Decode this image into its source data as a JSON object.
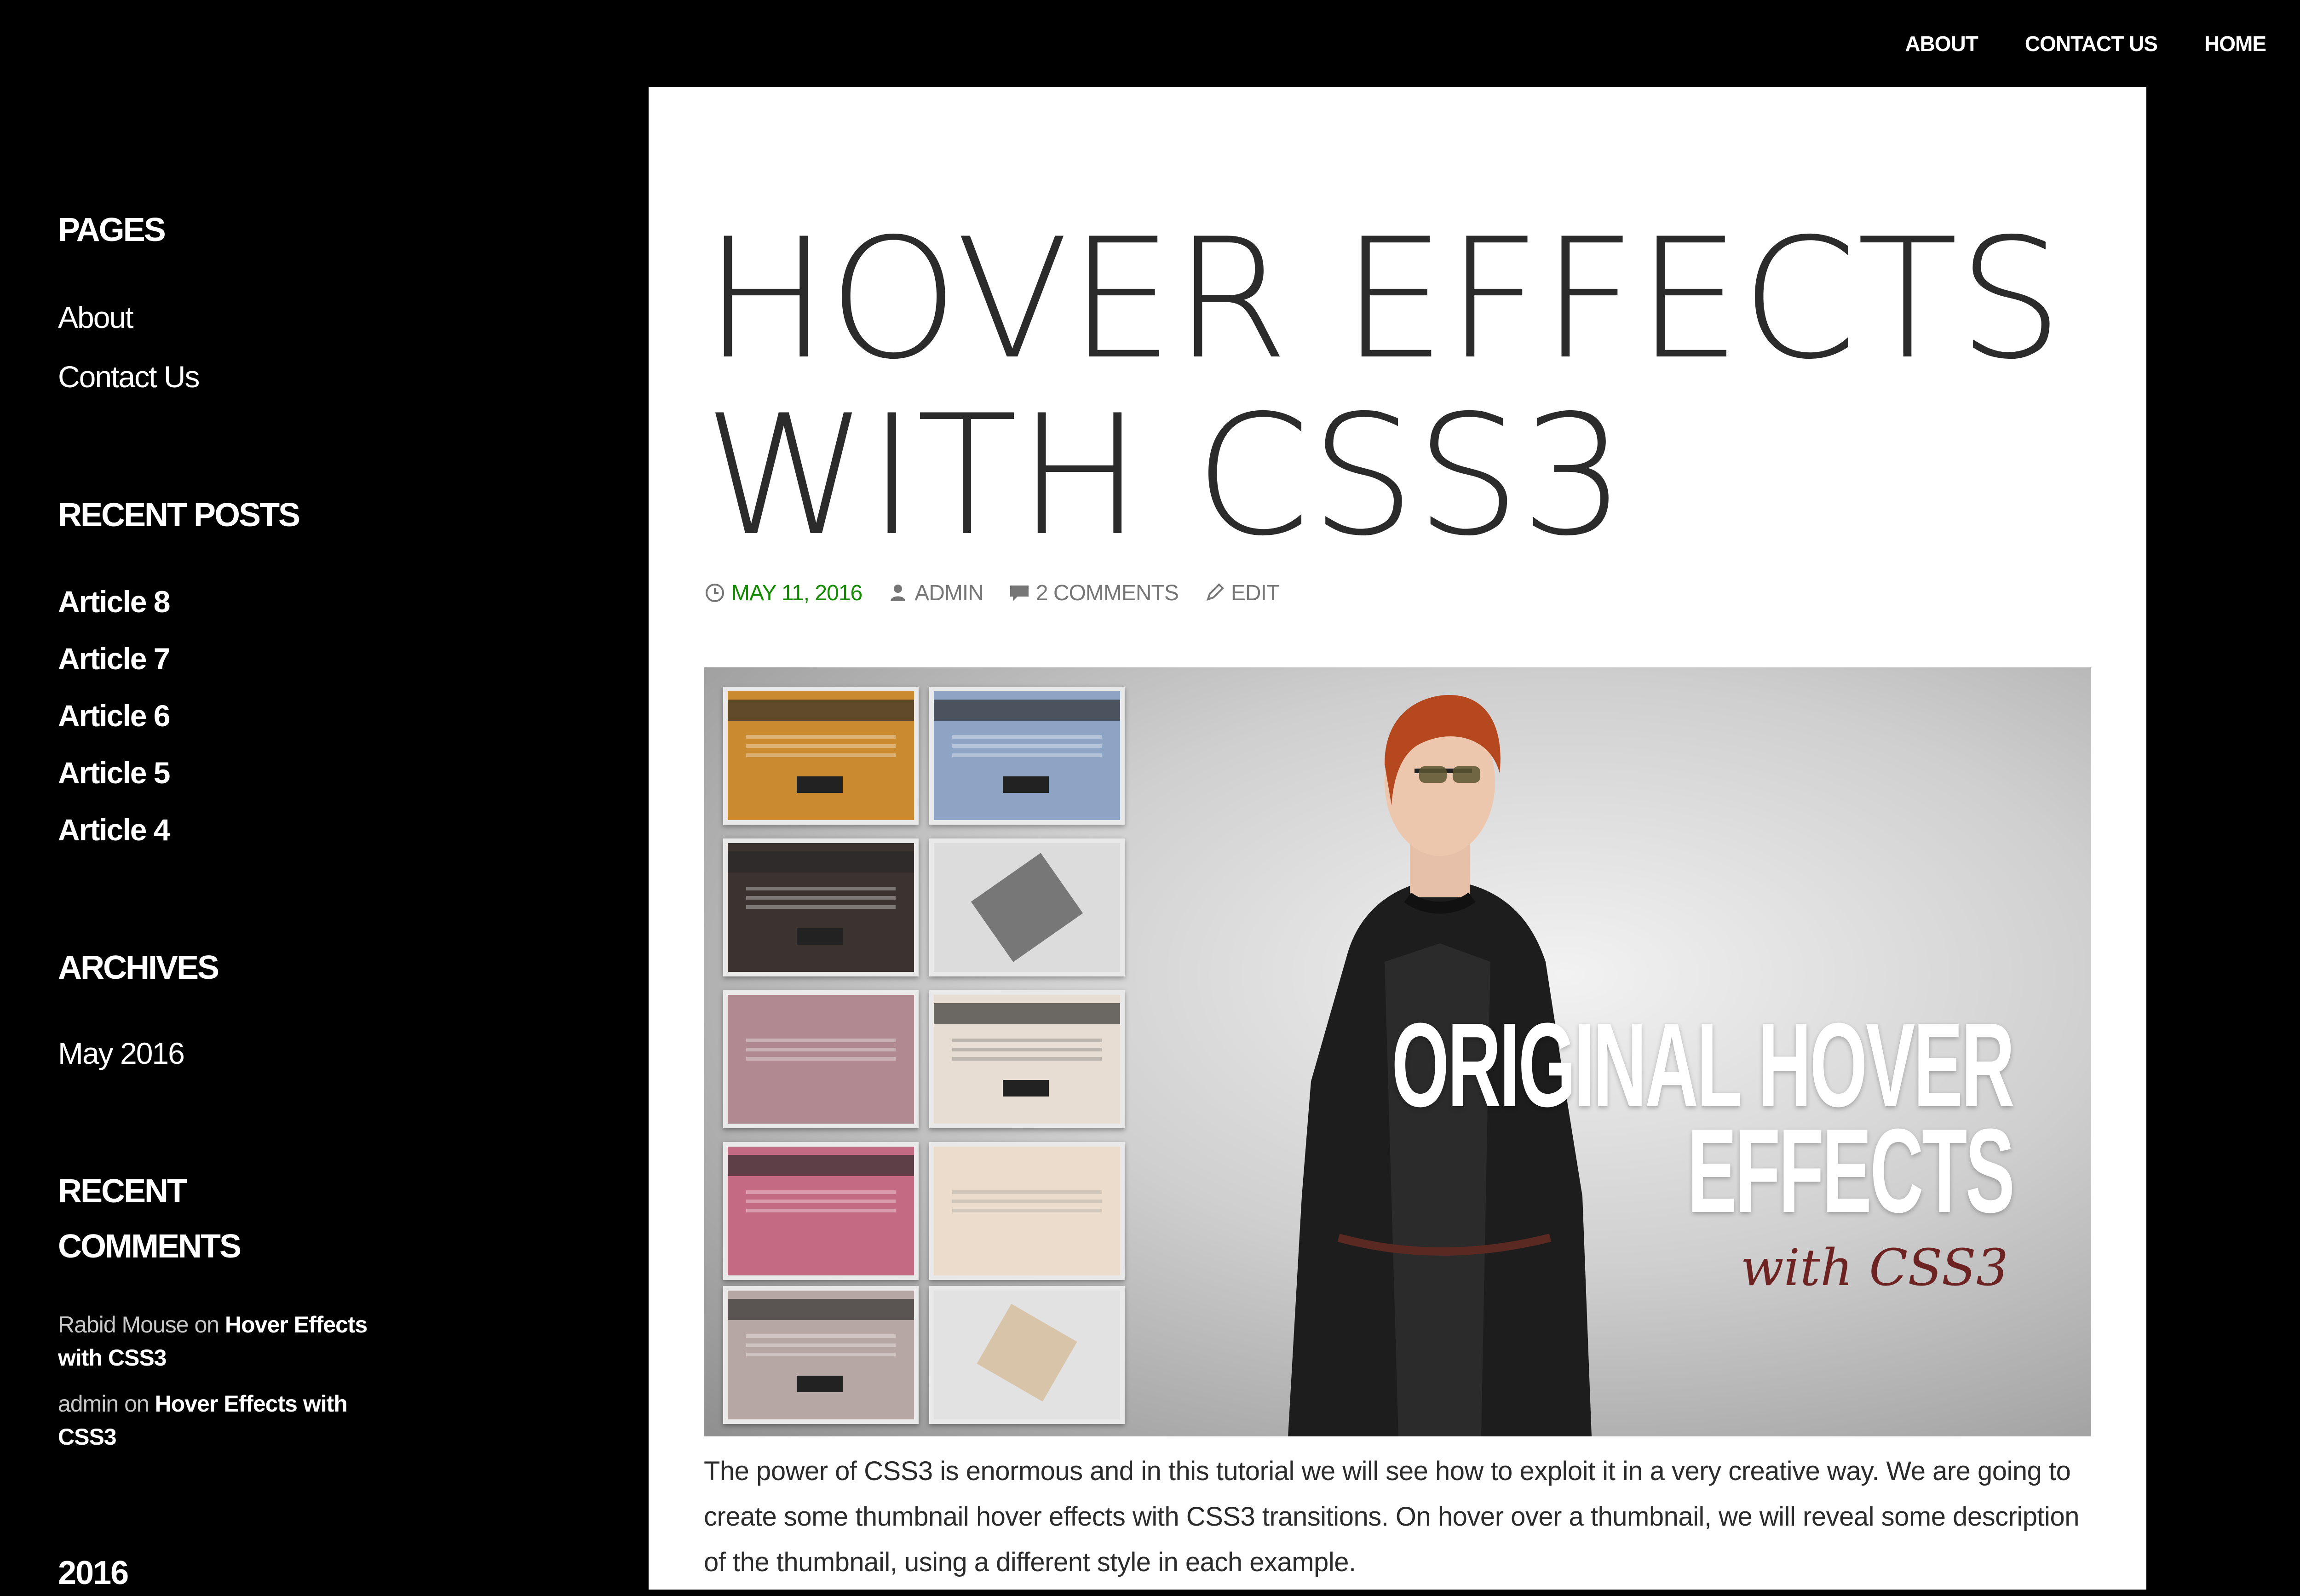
{
  "nav": {
    "items": [
      "ABOUT",
      "CONTACT US",
      "HOME"
    ],
    "search_icon": "search-icon",
    "accent_color": "#6d34d4"
  },
  "sidebar": {
    "pages": {
      "title": "PAGES",
      "items": [
        "About",
        "Contact Us"
      ]
    },
    "recent_posts": {
      "title": "RECENT POSTS",
      "items": [
        "Article 8",
        "Article 7",
        "Article 6",
        "Article 5",
        "Article 4"
      ]
    },
    "archives": {
      "title": "ARCHIVES",
      "items": [
        "May 2016"
      ]
    },
    "recent_comments": {
      "title_line1": "RECENT",
      "title_line2": "COMMENTS",
      "items": [
        {
          "author": "Rabid Mouse",
          "on": " on ",
          "post": "Hover Effects with CSS3"
        },
        {
          "author": "admin",
          "on": " on ",
          "post": "Hover Effects with CSS3"
        }
      ]
    },
    "year_title": "2016"
  },
  "post": {
    "title_line1": "HOVER EFFECTS",
    "title_line2": "WITH CSS3",
    "meta": {
      "date": "MAY 11, 2016",
      "author": "ADMIN",
      "comments": "2 COMMENTS",
      "edit": "EDIT",
      "date_color": "#148a00"
    },
    "featured_image": {
      "headline_line1": "ORIGINAL HOVER",
      "headline_line2": "EFFECTS",
      "subline": "with CSS3"
    },
    "body": "The power of CSS3 is enormous and in this tutorial we will see how to exploit it in a very creative way. We are going to create some thumbnail hover effects with CSS3 transitions. On hover over a thumbnail, we will reveal some description of the thumbnail, using a different style in each example."
  }
}
